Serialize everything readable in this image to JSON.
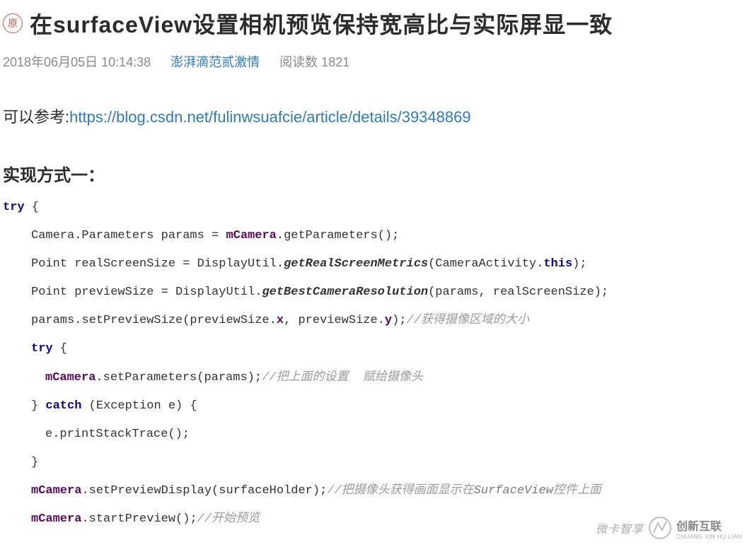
{
  "badge": "原",
  "title": "在surfaceView设置相机预览保持宽高比与实际屏显一致",
  "meta": {
    "date": "2018年06月05日 10:14:38",
    "author": "澎湃滴范贰激情",
    "reads_label": "阅读数",
    "reads_count": "1821"
  },
  "reference": {
    "label": "可以参考:",
    "url": "https://blog.csdn.net/fulinwsuafcie/article/details/39348869"
  },
  "section_heading": "实现方式一：",
  "code": {
    "l1_kw": "try",
    "l1_rest": " {",
    "l2_a": "Camera.Parameters params = ",
    "l2_m": "mCamera",
    "l2_b": ".getParameters();",
    "l3_a": "Point realScreenSize = DisplayUtil.",
    "l3_f": "getRealScreenMetrics",
    "l3_b": "(CameraActivity.",
    "l3_kw": "this",
    "l3_c": ");",
    "l4_a": "Point previewSize = DisplayUtil.",
    "l4_f": "getBestCameraResolution",
    "l4_b": "(params, realScreenSize);",
    "l5_a": "params.setPreviewSize(previewSize.",
    "l5_m1": "x",
    "l5_b": ", previewSize.",
    "l5_m2": "y",
    "l5_c": ");",
    "l5_comment": "//获得摄像区域的大小",
    "l6_kw": "try",
    "l6_rest": " {",
    "l7_m": "mCamera",
    "l7_a": ".setParameters(params);",
    "l7_comment": "//把上面的设置  赋给摄像头",
    "l8_a": "} ",
    "l8_kw": "catch",
    "l8_b": " (Exception e) {",
    "l9": "e.printStackTrace();",
    "l10": "}",
    "l11_m": "mCamera",
    "l11_a": ".setPreviewDisplay(surfaceHolder);",
    "l11_comment_a": "//把摄像头获得画面显示在",
    "l11_comment_b": "SurfaceView",
    "l11_comment_c": "控件上面",
    "l12_m": "mCamera",
    "l12_a": ".startPreview();",
    "l12_comment": "//开始预览"
  },
  "watermark": {
    "text": "微卡智享",
    "brand_cn": "创新互联",
    "brand_en": "CHUANG XIN HU LIAN"
  }
}
